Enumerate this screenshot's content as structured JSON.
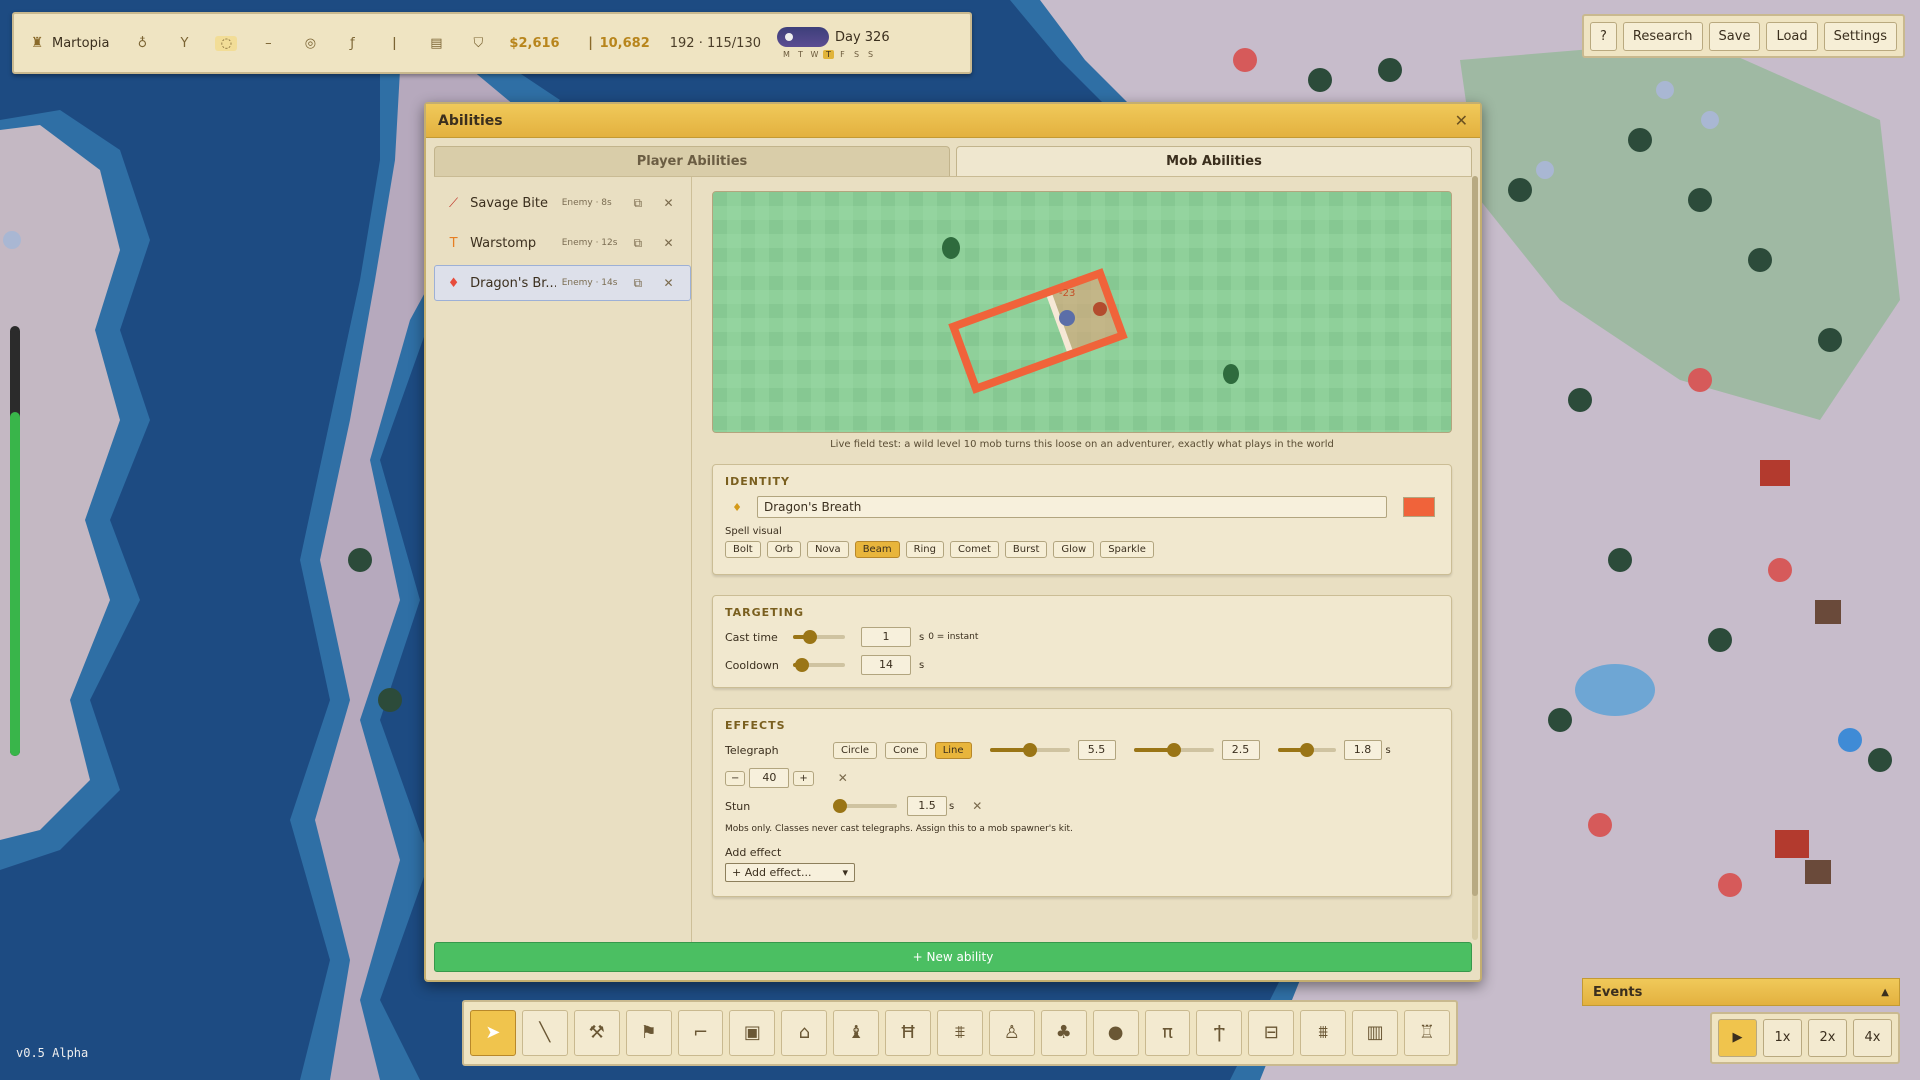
{
  "hud": {
    "kingdom_name": "Martopia",
    "gold": "$2,616",
    "population": "10,682",
    "counts": "192 · 115/130",
    "day": "Day 326",
    "weekdays": [
      "M",
      "T",
      "W",
      "T",
      "F",
      "S",
      "S"
    ],
    "today_index": 3
  },
  "top_buttons": [
    "?",
    "Research",
    "Save",
    "Load",
    "Settings"
  ],
  "dialog": {
    "title": "Abilities",
    "close": "✕",
    "tabs": [
      "Player Abilities",
      "Mob Abilities"
    ],
    "active_tab": 1,
    "abilities": [
      {
        "name": "Savage Bite",
        "meta": "Enemy · 8s",
        "icon": "claw-icon",
        "color": "#c0392b"
      },
      {
        "name": "Warstomp",
        "meta": "Enemy · 12s",
        "icon": "hammer-icon",
        "color": "#e67e22"
      },
      {
        "name": "Dragon's Br...",
        "meta": "Enemy · 14s",
        "icon": "flame-icon",
        "color": "#e74c3c"
      }
    ],
    "selected_ability": 2,
    "preview_caption": "Live field test: a wild level 10 mob turns this loose on an adventurer, exactly what plays in the world",
    "preview_damage": "-23",
    "identity": {
      "title": "IDENTITY",
      "name_value": "Dragon's Breath",
      "color": "#f0633a",
      "spell_visual_label": "Spell visual",
      "visuals": [
        "Bolt",
        "Orb",
        "Nova",
        "Beam",
        "Ring",
        "Comet",
        "Burst",
        "Glow",
        "Sparkle"
      ],
      "active_visual": 3
    },
    "targeting": {
      "title": "TARGETING",
      "cast_time_label": "Cast time",
      "cast_time": "1",
      "cast_unit": "s",
      "cast_note": "0 = instant",
      "cooldown_label": "Cooldown",
      "cooldown": "14",
      "cooldown_unit": "s"
    },
    "effects": {
      "title": "EFFECTS",
      "telegraph_label": "Telegraph",
      "shapes": [
        "Circle",
        "Cone",
        "Line"
      ],
      "active_shape": 2,
      "length": "5.5",
      "width": "2.5",
      "duration": "1.8",
      "duration_unit": "s",
      "damage": "40",
      "minus": "−",
      "plus": "+",
      "stun_label": "Stun",
      "stun": "1.5",
      "stun_unit": "s",
      "note": "Mobs only. Classes never cast telegraphs. Assign this to a mob spawner's kit.",
      "add_effect_label": "Add effect",
      "add_effect_select": "+ Add effect..."
    },
    "new_ability": "+ New ability"
  },
  "events": {
    "title": "Events",
    "chevron": "▲"
  },
  "speed": {
    "play": "▶",
    "options": [
      "1x",
      "2x",
      "4x"
    ]
  },
  "version": "v0.5 Alpha"
}
